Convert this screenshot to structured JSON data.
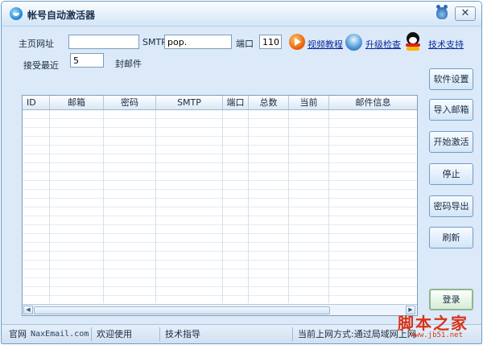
{
  "window": {
    "title": "帐号自动激活器",
    "close_glyph": "✕"
  },
  "form": {
    "homepage_label": "主页网址",
    "homepage_value": "",
    "smtp_label": "SMTP",
    "smtp_value": "pop.",
    "port_label": "端口",
    "port_value": "110",
    "recent_label": "接受最近",
    "recent_value": "5",
    "recent_suffix": "封邮件"
  },
  "links": {
    "video": "视频教程",
    "upgrade": "升级检查",
    "support": "技术支持"
  },
  "icons": [
    "play-icon",
    "upgrade-globe-icon",
    "qq-penguin-icon",
    "app-logo-icon",
    "bear-icon"
  ],
  "table": {
    "columns": [
      "ID",
      "邮箱",
      "密码",
      "SMTP",
      "端口",
      "总数",
      "当前",
      "邮件信息"
    ],
    "rows": []
  },
  "sidebar": {
    "buttons": [
      "软件设置",
      "导入邮箱",
      "开始激活",
      "停止",
      "密码导出",
      "刷新"
    ],
    "login": "登录"
  },
  "statusbar": {
    "site_prefix": "官网",
    "site": "NaxEmail.com",
    "welcome": "欢迎使用",
    "guide": "技术指导",
    "network": "当前上网方式:通过局域网上网"
  },
  "watermark": {
    "text": "脚本之家",
    "url": "www.jb51.net"
  },
  "colors": {
    "window_bg": "#dbe9f8",
    "link": "#0b2a9c",
    "watermark": "#d93318"
  }
}
